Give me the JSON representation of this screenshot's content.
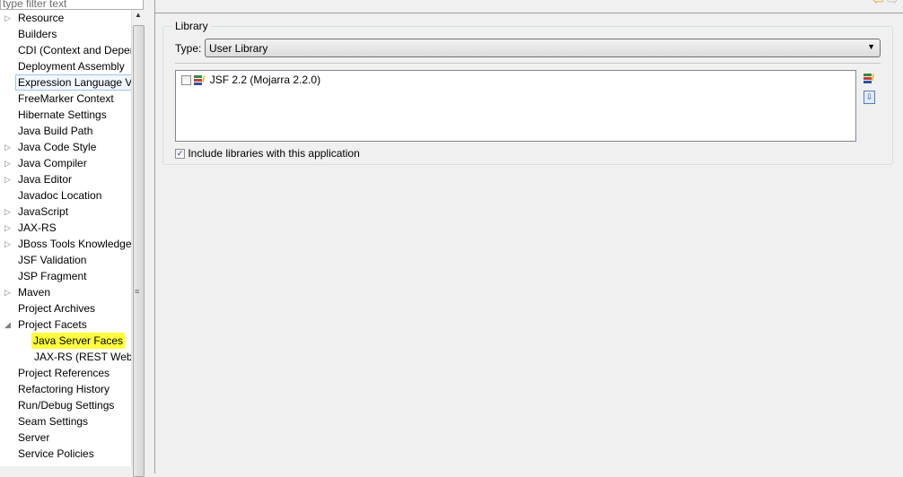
{
  "filter": {
    "placeholder": "type filter text"
  },
  "tree": [
    {
      "label": "Resource",
      "arrow": "▷"
    },
    {
      "label": "Builders",
      "arrow": ""
    },
    {
      "label": "CDI (Context and Dependency Injection)",
      "arrow": ""
    },
    {
      "label": "Deployment Assembly",
      "arrow": ""
    },
    {
      "label": "Expression Language Validation",
      "arrow": "",
      "selected": true
    },
    {
      "label": "FreeMarker Context",
      "arrow": ""
    },
    {
      "label": "Hibernate Settings",
      "arrow": ""
    },
    {
      "label": "Java Build Path",
      "arrow": ""
    },
    {
      "label": "Java Code Style",
      "arrow": "▷"
    },
    {
      "label": "Java Compiler",
      "arrow": "▷"
    },
    {
      "label": "Java Editor",
      "arrow": "▷"
    },
    {
      "label": "Javadoc Location",
      "arrow": ""
    },
    {
      "label": "JavaScript",
      "arrow": "▷"
    },
    {
      "label": "JAX-RS",
      "arrow": "▷"
    },
    {
      "label": "JBoss Tools Knowledge Base",
      "arrow": "▷"
    },
    {
      "label": "JSF Validation",
      "arrow": ""
    },
    {
      "label": "JSP Fragment",
      "arrow": ""
    },
    {
      "label": "Maven",
      "arrow": "▷"
    },
    {
      "label": "Project Archives",
      "arrow": ""
    },
    {
      "label": "Project Facets",
      "arrow": "◢"
    },
    {
      "label": "Java Server Faces",
      "arrow": "",
      "child": true,
      "highlight": true
    },
    {
      "label": "JAX-RS (REST Web Services)",
      "arrow": "",
      "child": true
    },
    {
      "label": "Project References",
      "arrow": ""
    },
    {
      "label": "Refactoring History",
      "arrow": ""
    },
    {
      "label": "Run/Debug Settings",
      "arrow": ""
    },
    {
      "label": "Seam Settings",
      "arrow": ""
    },
    {
      "label": "Server",
      "arrow": ""
    },
    {
      "label": "Service Policies",
      "arrow": ""
    }
  ],
  "library": {
    "group_label": "Library",
    "type_label": "Type:",
    "type_value": "User Library",
    "items": [
      {
        "label": "JSF 2.2 (Mojarra 2.2.0)",
        "checked": false
      }
    ],
    "include_label": "Include libraries with this application",
    "include_checked": true
  },
  "colors": {
    "highlight": "#ffff40",
    "selection": "#f2f8fd"
  }
}
